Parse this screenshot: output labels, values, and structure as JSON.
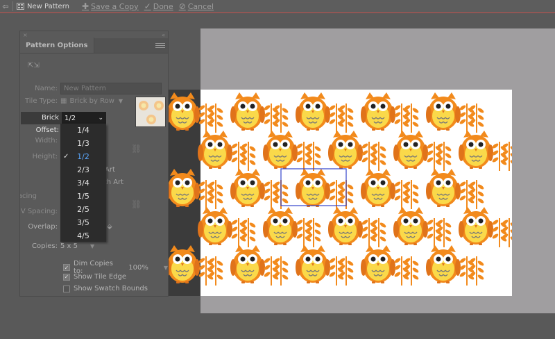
{
  "toolbar": {
    "back_icon": "arrow-left-icon",
    "pattern_name": "New Pattern",
    "save_copy": "Save a Copy",
    "done": "Done",
    "cancel": "Cancel"
  },
  "panel": {
    "title": "Pattern Options",
    "name_label": "Name:",
    "name_value": "New Pattern",
    "tile_type_label": "Tile Type:",
    "tile_type_value": "Brick by Row",
    "brick_offset_label": "Brick Offset:",
    "brick_offset_value": "1/2",
    "width_label": "Width:",
    "height_label": "Height:",
    "art_1": "Art",
    "art_2": "ith Art",
    "h_spacing_label": "H Spacing:",
    "v_spacing_label": "V Spacing:",
    "overlap_label": "Overlap:",
    "copies_label": "Copies:",
    "copies_value": "5 x 5",
    "dim_copies_label": "Dim Copies to:",
    "dim_copies_value": "100%",
    "show_tile_edge": "Show Tile Edge",
    "show_swatch_bounds": "Show Swatch Bounds",
    "dim_copies_checked": true,
    "show_tile_edge_checked": true,
    "show_swatch_bounds_checked": false
  },
  "brick_offset_options": [
    "1/4",
    "1/3",
    "1/2",
    "2/3",
    "3/4",
    "1/5",
    "2/5",
    "3/5",
    "4/5"
  ],
  "brick_offset_selected": "1/2",
  "colors": {
    "owl_orange": "#f28a1c",
    "owl_yellow": "#fad94a",
    "tile_frame": "#3344cc",
    "accent_red": "#c9514d",
    "selected_option": "#5aa8ff"
  }
}
